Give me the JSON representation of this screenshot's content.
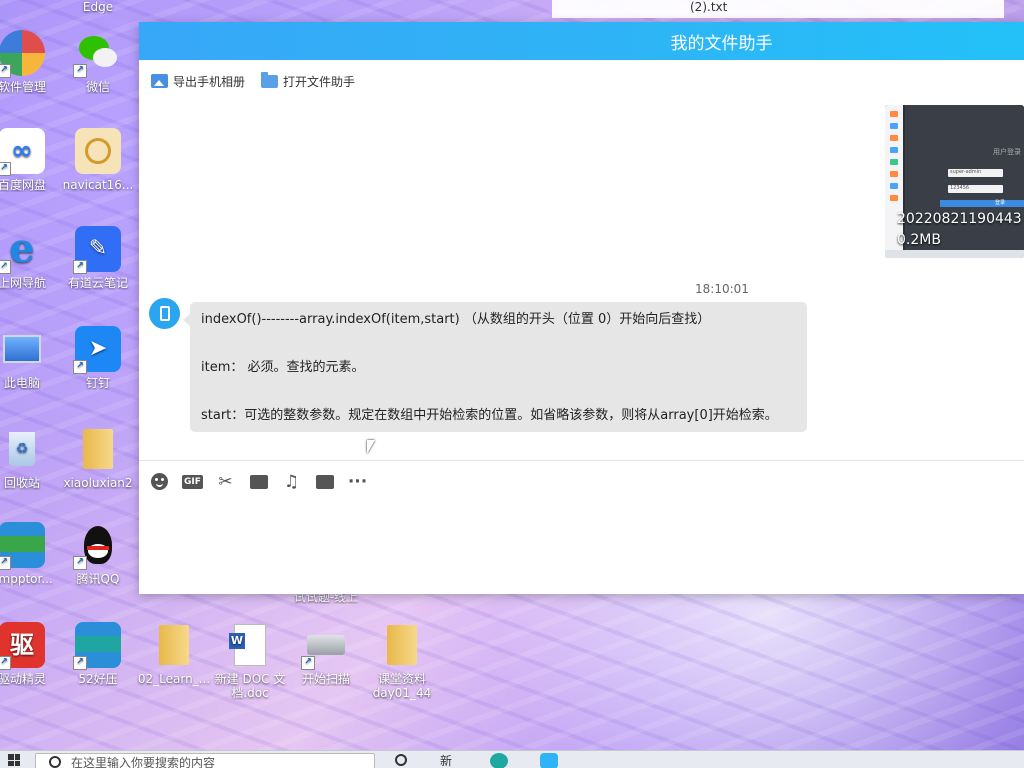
{
  "desktop": {
    "icons": [
      {
        "label": "Edge",
        "icon": "edge-icon",
        "color": "#1f8fe0"
      },
      {
        "label": "软件管理",
        "icon": "software-manager-icon",
        "color": "#e04d4d"
      },
      {
        "label": "微信",
        "icon": "wechat-icon",
        "color": "#2dc100"
      },
      {
        "label": "百度网盘",
        "icon": "baidu-netdisk-icon",
        "color": "#2e7cf6"
      },
      {
        "label": "navicat16...",
        "icon": "navicat-icon",
        "color": "#f2c46b"
      },
      {
        "label": "上网导航",
        "icon": "ie-browser-icon",
        "color": "#1e88e5"
      },
      {
        "label": "有道云笔记",
        "icon": "youdao-note-icon",
        "color": "#2f6ef5"
      },
      {
        "label": "此电脑",
        "icon": "this-pc-icon",
        "color": "#3b7dd8"
      },
      {
        "label": "钉钉",
        "icon": "dingtalk-icon",
        "color": "#1d87f5"
      },
      {
        "label": "回收站",
        "icon": "recycle-bin-icon",
        "color": "#8ab4d8"
      },
      {
        "label": "xiaoluxian2",
        "icon": "folder-icon",
        "color": "#f3c957"
      },
      {
        "label": "ampptor...",
        "icon": "winrar-icon",
        "color": "#2a8fd8"
      },
      {
        "label": "腾讯QQ",
        "icon": "qq-icon",
        "color": "#111111"
      },
      {
        "label": "驱动精灵",
        "icon": "driver-genius-icon",
        "color": "#e0332e"
      },
      {
        "label": "52好压",
        "icon": "haozip-icon",
        "color": "#2a8fd8"
      },
      {
        "label": "02_Learn_...",
        "icon": "folder-icon",
        "color": "#f3c957"
      },
      {
        "label": "新建 DOC 文档.doc",
        "icon": "word-doc-icon",
        "color": "#2b5fb8"
      },
      {
        "label": "开始扫描",
        "icon": "scanner-icon",
        "color": "#9aa0a6"
      },
      {
        "label": "课堂资料day01_44",
        "icon": "folder-icon",
        "color": "#f3c957"
      },
      {
        "label": "试试题-线上",
        "icon": "partial-label",
        "color": "#ffffff"
      }
    ],
    "top_fragment": "(2).txt"
  },
  "chat": {
    "title": "我的文件助手",
    "header_gradient": [
      "#37a7f7",
      "#23c1f8"
    ],
    "toolbar": {
      "export_photos": "导出手机相册",
      "open_assistant": "打开文件助手"
    },
    "file_message": {
      "name": "20220821190443",
      "size": "0.2MB",
      "thumb_title": "用户登录",
      "thumb_input_1": "super-admin",
      "thumb_input_2": "123456",
      "thumb_button": "登录"
    },
    "timestamp": "18:10:01",
    "text_message": {
      "line1": "indexOf()--------array.indexOf(item,start) （从数组的开头（位置 0）开始向后查找）",
      "line2": "item： 必须。查找的元素。",
      "line3": "start：可选的整数参数。规定在数组中开始检索的位置。如省略该参数，则将从array[0]开始检索。"
    },
    "input_toolbar": {
      "gif": "GIF",
      "more": "···"
    }
  },
  "taskbar": {
    "search_placeholder": "在这里输入你要搜索的内容",
    "fragment": "新"
  }
}
